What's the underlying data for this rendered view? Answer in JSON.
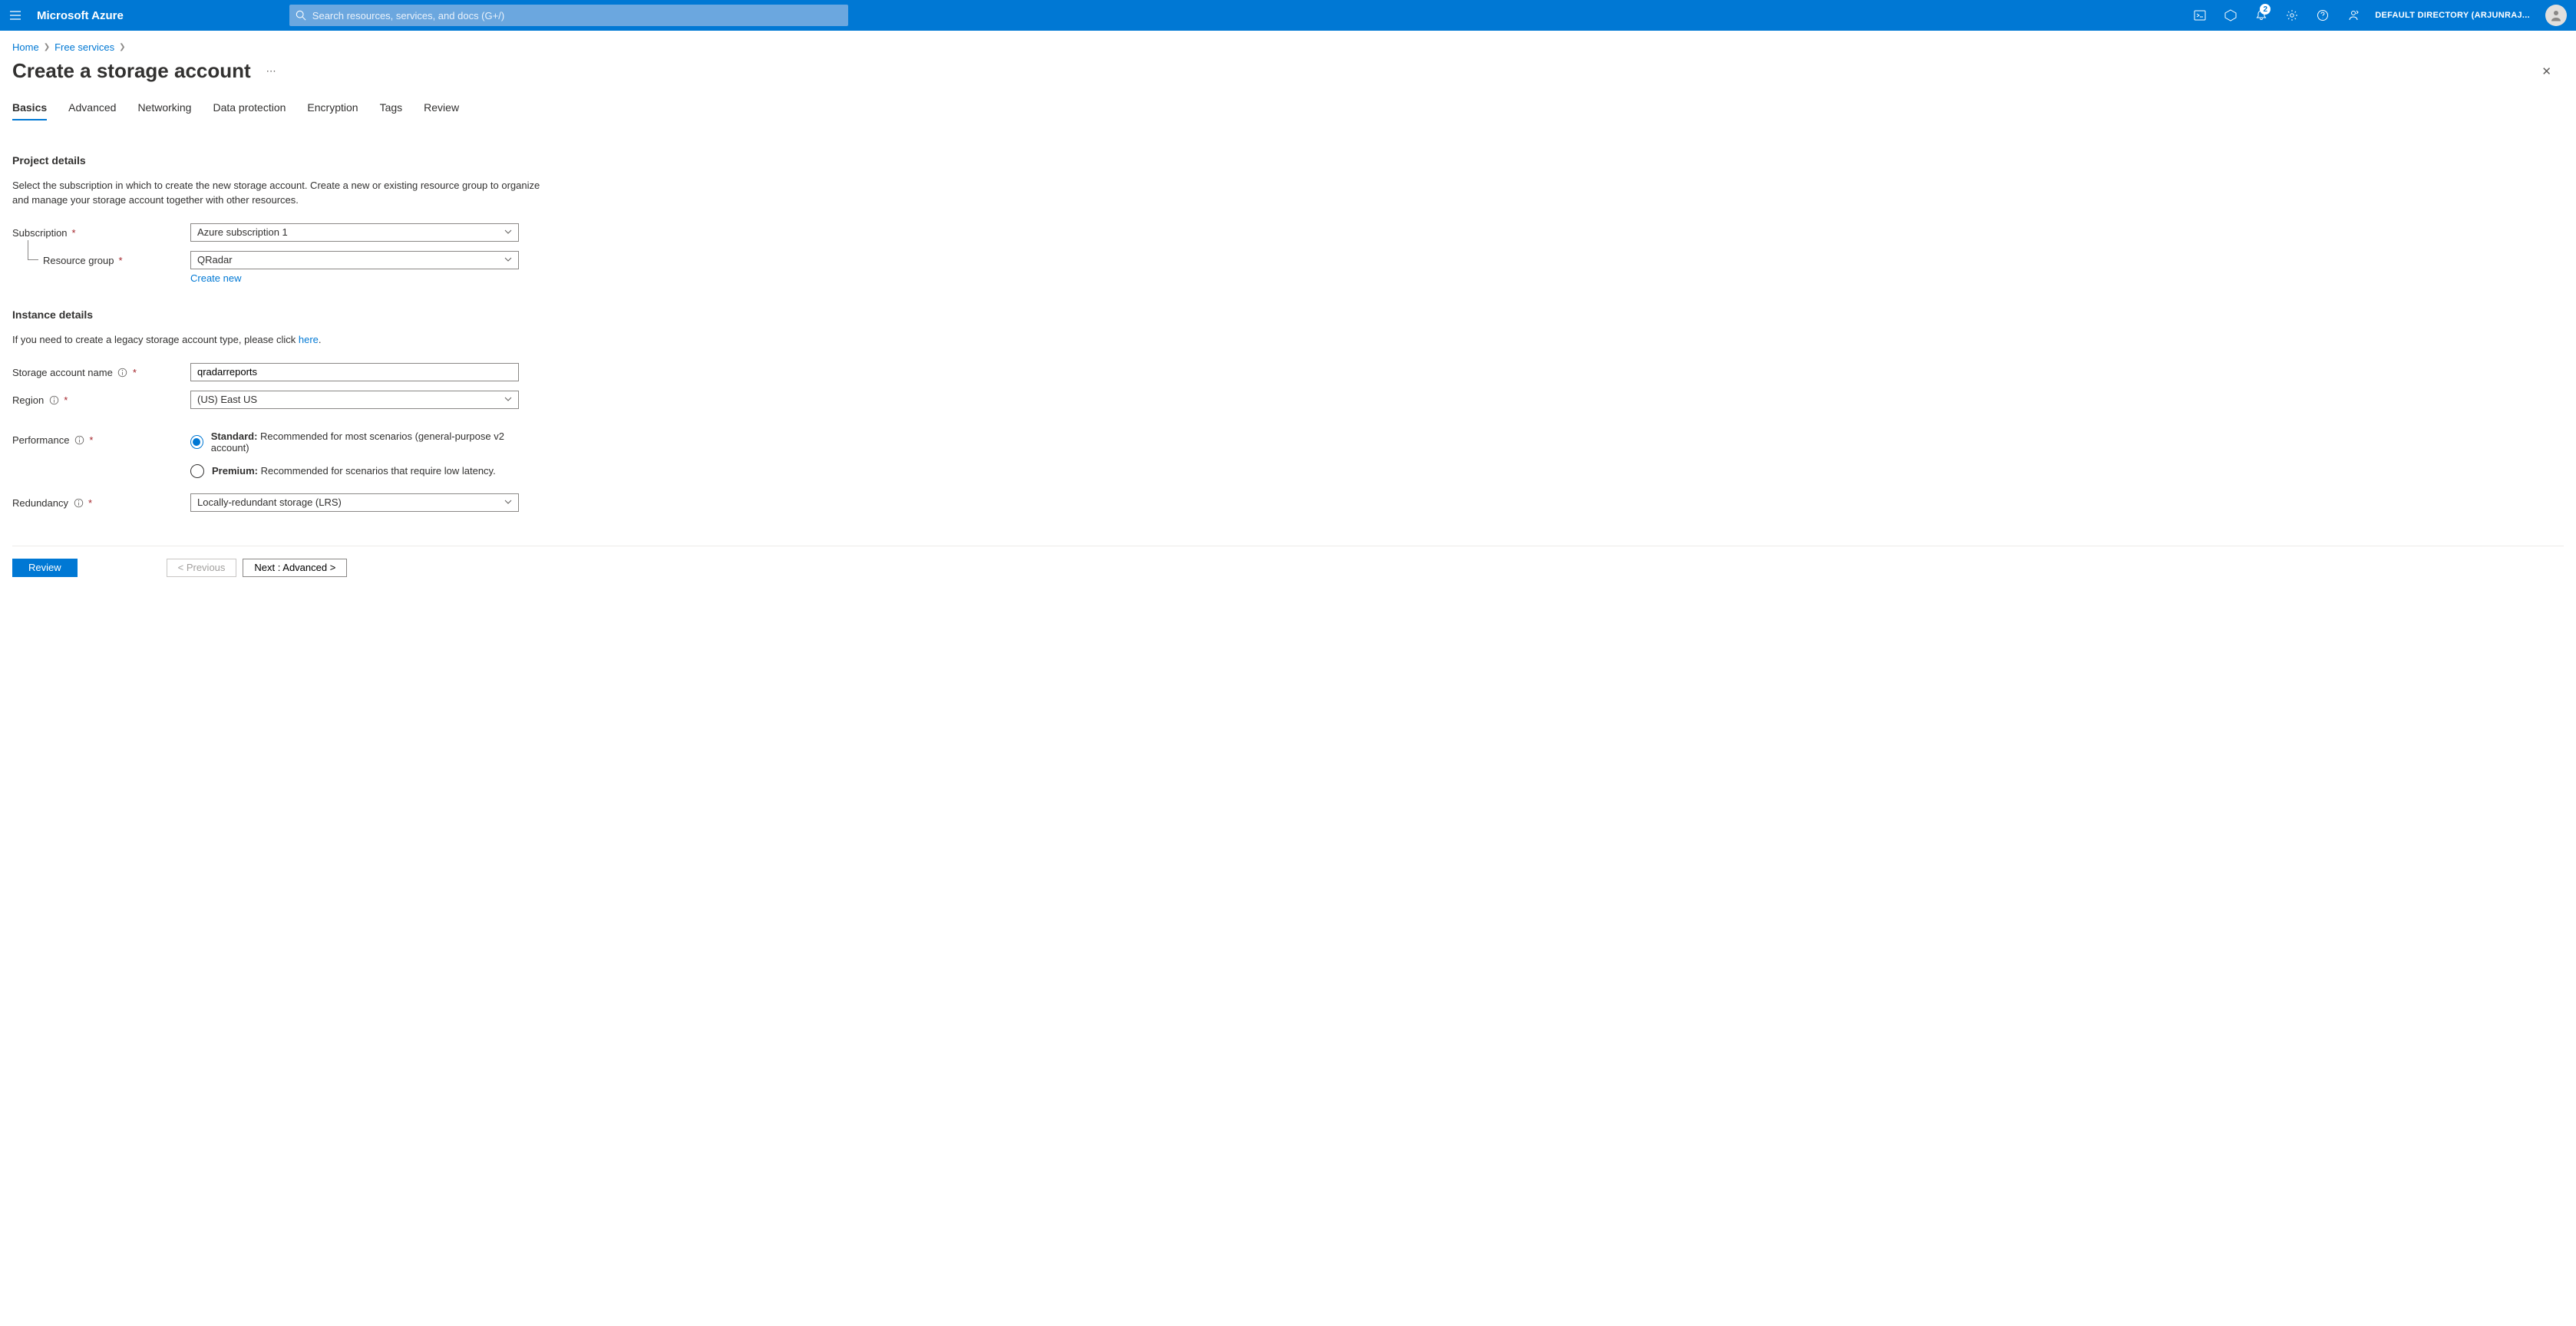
{
  "header": {
    "brand": "Microsoft Azure",
    "search_placeholder": "Search resources, services, and docs (G+/)",
    "notification_badge": "2",
    "tenant": "DEFAULT DIRECTORY (ARJUNRAJ..."
  },
  "breadcrumb": {
    "items": [
      "Home",
      "Free services"
    ]
  },
  "title": "Create a storage account",
  "tabs": [
    "Basics",
    "Advanced",
    "Networking",
    "Data protection",
    "Encryption",
    "Tags",
    "Review"
  ],
  "active_tab_index": 0,
  "sections": {
    "project": {
      "heading": "Project details",
      "desc": "Select the subscription in which to create the new storage account. Create a new or existing resource group to organize and manage your storage account together with other resources.",
      "subscription_label": "Subscription",
      "subscription_value": "Azure subscription 1",
      "rg_label": "Resource group",
      "rg_value": "QRadar",
      "create_new": "Create new"
    },
    "instance": {
      "heading": "Instance details",
      "desc_prefix": "If you need to create a legacy storage account type, please click ",
      "desc_link": "here",
      "desc_suffix": ".",
      "name_label": "Storage account name",
      "name_value": "qradarreports",
      "region_label": "Region",
      "region_value": "(US) East US",
      "perf_label": "Performance",
      "perf_options": [
        {
          "strong": "Standard:",
          "rest": " Recommended for most scenarios (general-purpose v2 account)",
          "checked": true
        },
        {
          "strong": "Premium:",
          "rest": " Recommended for scenarios that require low latency.",
          "checked": false
        }
      ],
      "redundancy_label": "Redundancy",
      "redundancy_value": "Locally-redundant storage (LRS)"
    }
  },
  "footer": {
    "review": "Review",
    "previous": "< Previous",
    "next": "Next : Advanced >"
  }
}
